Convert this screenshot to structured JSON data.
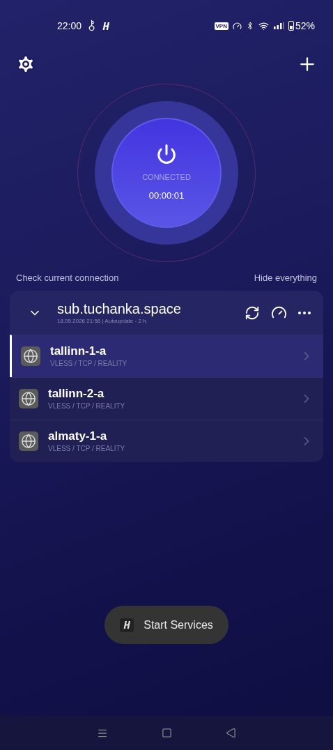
{
  "status_bar": {
    "time": "22:00",
    "vpn_badge": "VPN",
    "battery": "52%"
  },
  "connection": {
    "connected": true,
    "status": "CONNECTED",
    "timer": "00:00:01"
  },
  "links": [
    "Check current connection",
    "Hide everything"
  ],
  "subscription": {
    "name": "sub.tuchanka.space",
    "details": "18.05.2026 21:56 | Autoupdate - 2 h.",
    "expanded": true,
    "servers": [
      {
        "name": "tallinn-1-a",
        "protocol": "VLESS / TCP / REALITY",
        "selected": true
      },
      {
        "name": "tallinn-2-a",
        "protocol": "VLESS / TCP / REALITY",
        "selected": false
      },
      {
        "name": "almaty-1-a",
        "protocol": "VLESS / TCP / REALITY",
        "selected": false
      }
    ]
  },
  "toast": {
    "text": "Start Services"
  }
}
